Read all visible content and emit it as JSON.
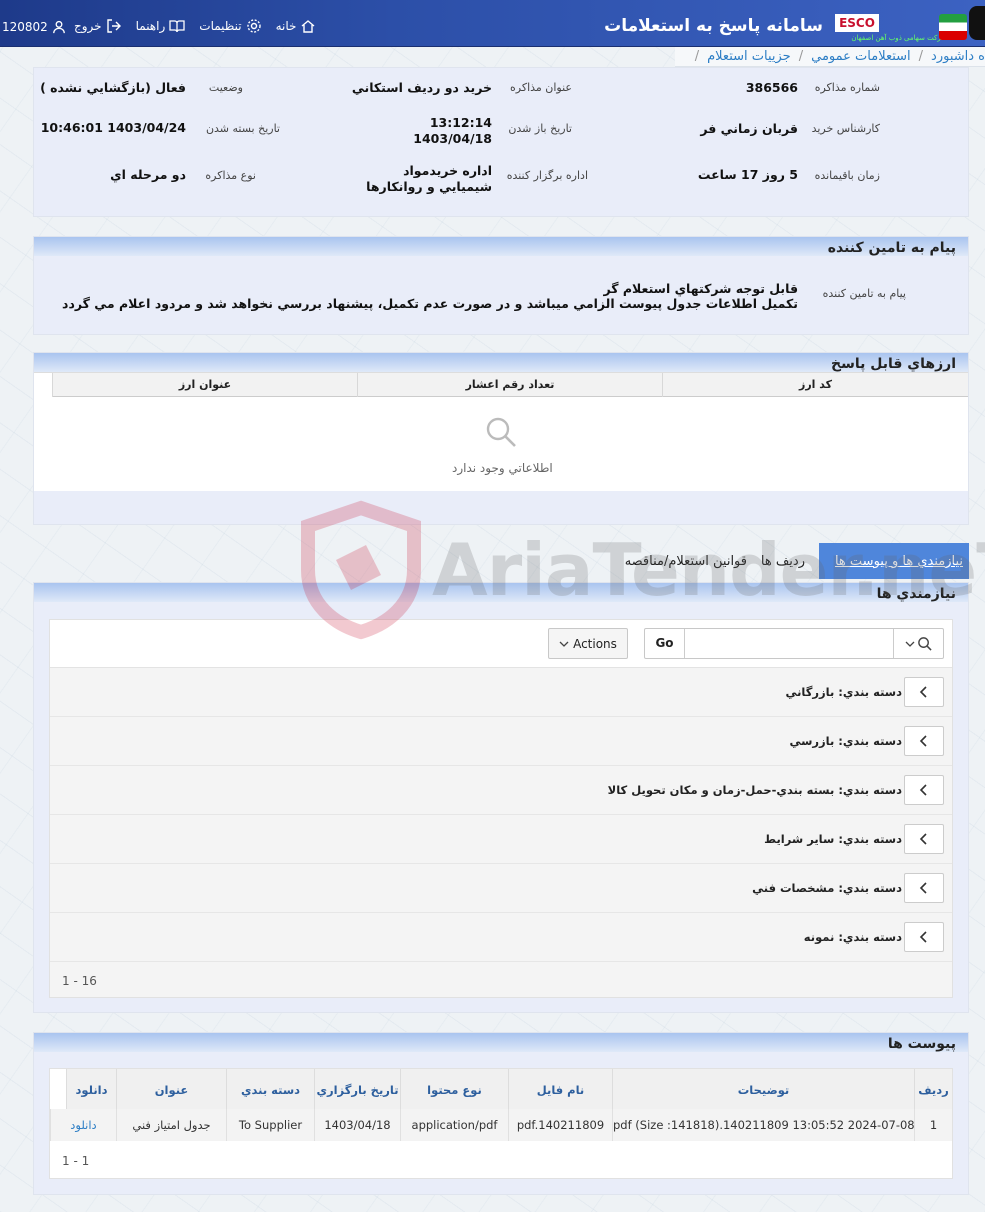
{
  "header": {
    "app_title": "سامانه پاسخ به استعلامات",
    "brand": "ESCO",
    "brand_sub": "شرکت سهامی ذوب آهن اصفهان",
    "user_id": "120802",
    "nav": {
      "home": "خانه",
      "settings": "تنظيمات",
      "help": "راهنما",
      "logout": "خروج"
    }
  },
  "breadcrumb": {
    "items": [
      "ه داشبورد",
      "استعلامات عمومي",
      "جزييات استعلام"
    ]
  },
  "details": {
    "labels": {
      "number": "شماره مذاكره",
      "subject": "عنوان مذاكره",
      "status": "وضعيت",
      "expert": "كارشناس خريد",
      "open_date": "تاريخ باز شدن",
      "close_date": "تاريخ بسته شدن",
      "remaining": "زمان باقيمانده",
      "dept": "اداره برگزار كننده",
      "type": "نوع مذاكره"
    },
    "values": {
      "number": "386566",
      "subject": "خريد دو رديف استكاني",
      "status": "فعال (بازگشايي نشده )",
      "expert": "قربان زماني فر",
      "open_time": "13:12:14",
      "open_date": "1403/04/18",
      "close_date": "1403/04/24 10:46:01",
      "remaining": "5 روز 17 ساعت",
      "dept_line1": "اداره خريدمواد",
      "dept_line2": "شيميايي و روانكارها",
      "type": "دو مرحله اي"
    }
  },
  "supplier_message": {
    "title": "پيام به تامين كننده",
    "label": "پيام به تامين كننده",
    "line1": "قابل توجه شركتهاي استعلام گر",
    "line2": "تكميل اطلاعات جدول پيوست الزامي ميباشد و در صورت عدم تكميل، پيشنهاد بررسي نخواهد شد و مردود اعلام مي گردد"
  },
  "currencies": {
    "title": "ارزهاي قابل پاسخ",
    "columns": [
      "كد ارز",
      "تعداد رقم اعشار",
      "عنوان ارز"
    ],
    "empty": "اطلاعاتي وجود ندارد"
  },
  "tabs": {
    "active": "نيازمندي ها و پيوست ها",
    "items": [
      "رديف ها",
      "قوانين استعلام/مناقصه"
    ]
  },
  "requirements": {
    "title": "نيازمندي ها",
    "go": "Go",
    "actions": "Actions",
    "rows": [
      "دسته بندي: بازرگاني",
      "دسته بندي: بازرسي",
      "دسته بندي: بسته بندي-حمل-زمان و مكان تحويل كالا",
      "دسته بندي: ساير شرايط",
      "دسته بندي: مشخصات فني",
      "دسته بندي: نمونه"
    ],
    "pager": "1 - 16"
  },
  "attachments": {
    "title": "پيوست ها",
    "columns": [
      "رديف",
      "توضيحات",
      "نام فايل",
      "نوع محتوا",
      "تاريخ بارگزاري",
      "دسته بندي",
      "عنوان",
      "دانلود"
    ],
    "rows": [
      [
        "1",
        "pdf (Size :141818).140211809 13:05:52 2024-07-08",
        "pdf.140211809",
        "application/pdf",
        "1403/04/18",
        "To Supplier",
        "جدول امتياز فني",
        "دانلود"
      ]
    ],
    "pager": "1 - 1"
  },
  "watermark": "AriaTender.neT"
}
